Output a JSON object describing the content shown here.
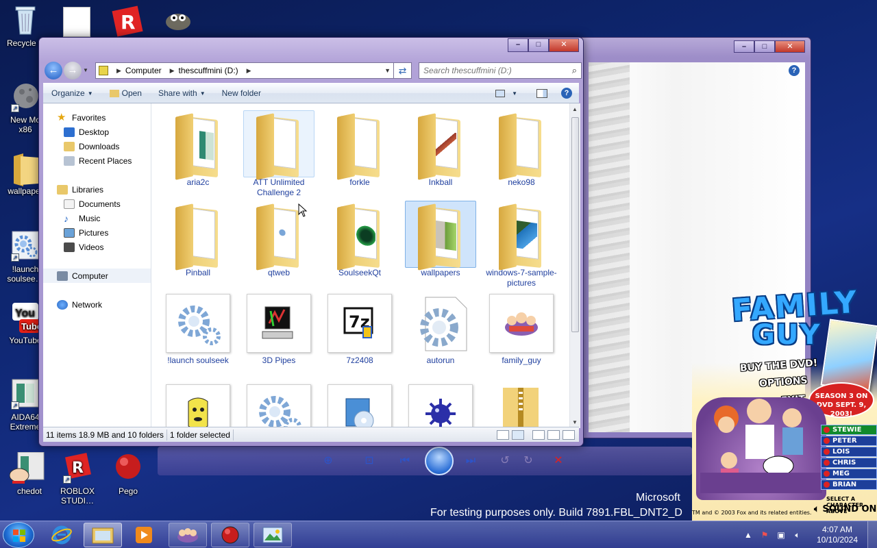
{
  "desktop": {
    "icons": [
      {
        "label": "Recycle B",
        "icon": "recycle-bin-icon"
      },
      {
        "label": "New Mo\nx86",
        "icon": "moon-icon"
      },
      {
        "label": "wallpaper",
        "icon": "folder-icon"
      },
      {
        "label": "!launch\nsoulsee…",
        "icon": "gear-icon"
      },
      {
        "label": "YouTube",
        "icon": "youtube-icon"
      },
      {
        "label": "AIDA64\nExtreme",
        "icon": "aida-icon"
      },
      {
        "label": "chedot",
        "icon": "stewie-icon"
      },
      {
        "label": "ROBLOX\nSTUDI…",
        "icon": "roblox-icon"
      },
      {
        "label": "Pego",
        "icon": "red-ball-icon"
      }
    ]
  },
  "explorer": {
    "address": {
      "segments": [
        "Computer",
        "thescuffmini (D:)"
      ]
    },
    "search": {
      "placeholder": "Search thescuffmini (D:)"
    },
    "toolbar": {
      "organize": "Organize",
      "open": "Open",
      "share_with": "Share with",
      "new_folder": "New folder"
    },
    "nav": {
      "favorites": "Favorites",
      "desktop": "Desktop",
      "downloads": "Downloads",
      "recent_places": "Recent Places",
      "libraries": "Libraries",
      "documents": "Documents",
      "music": "Music",
      "pictures": "Pictures",
      "videos": "Videos",
      "computer": "Computer",
      "network": "Network"
    },
    "items": [
      {
        "label": "aria2c",
        "kind": "folder"
      },
      {
        "label": "ATT Unlimited Challenge 2",
        "kind": "folder",
        "state": "hover"
      },
      {
        "label": "forkle",
        "kind": "folder"
      },
      {
        "label": "Inkball",
        "kind": "folder"
      },
      {
        "label": "neko98",
        "kind": "folder"
      },
      {
        "label": "Pinball",
        "kind": "folder"
      },
      {
        "label": "qtweb",
        "kind": "folder"
      },
      {
        "label": "SoulseekQt",
        "kind": "folder"
      },
      {
        "label": "wallpapers",
        "kind": "folder",
        "state": "selected"
      },
      {
        "label": "windows-7-sample-pictures",
        "kind": "folder"
      },
      {
        "label": "!launch soulseek",
        "kind": "file",
        "icon": "gear-icon"
      },
      {
        "label": "3D Pipes",
        "kind": "file",
        "icon": "computer-icon"
      },
      {
        "label": "7z2408",
        "kind": "file",
        "icon": "7zip-icon"
      },
      {
        "label": "autorun",
        "kind": "file",
        "icon": "gear-file-icon"
      },
      {
        "label": "family_guy",
        "kind": "file",
        "icon": "family-guy-icon"
      }
    ],
    "status": {
      "summary": "11 items 18.9 MB and 10 folders",
      "selection": "1 folder selected"
    }
  },
  "watermark": {
    "line1": "Microsoft",
    "line2": "For testing purposes only. Build 7891.FBL_DNT2_D"
  },
  "family_guy": {
    "title1": "FAMILY",
    "title2": "GUY",
    "menu": [
      "BUY THE DVD!",
      "OPTIONS",
      "EXIT"
    ],
    "season": "SEASON 3 ON DVD SEPT. 9, 2003!",
    "characters": [
      "STEWIE",
      "PETER",
      "LOIS",
      "CHRIS",
      "MEG",
      "BRIAN"
    ],
    "hint": "SELECT A CHARACTER ABOVE",
    "copyright": "TM and © 2003 Fox and its related entities.",
    "sound": "SOUND ON"
  },
  "taskbar": {
    "clock_time": "4:07 AM",
    "clock_date": "10/10/2024"
  }
}
